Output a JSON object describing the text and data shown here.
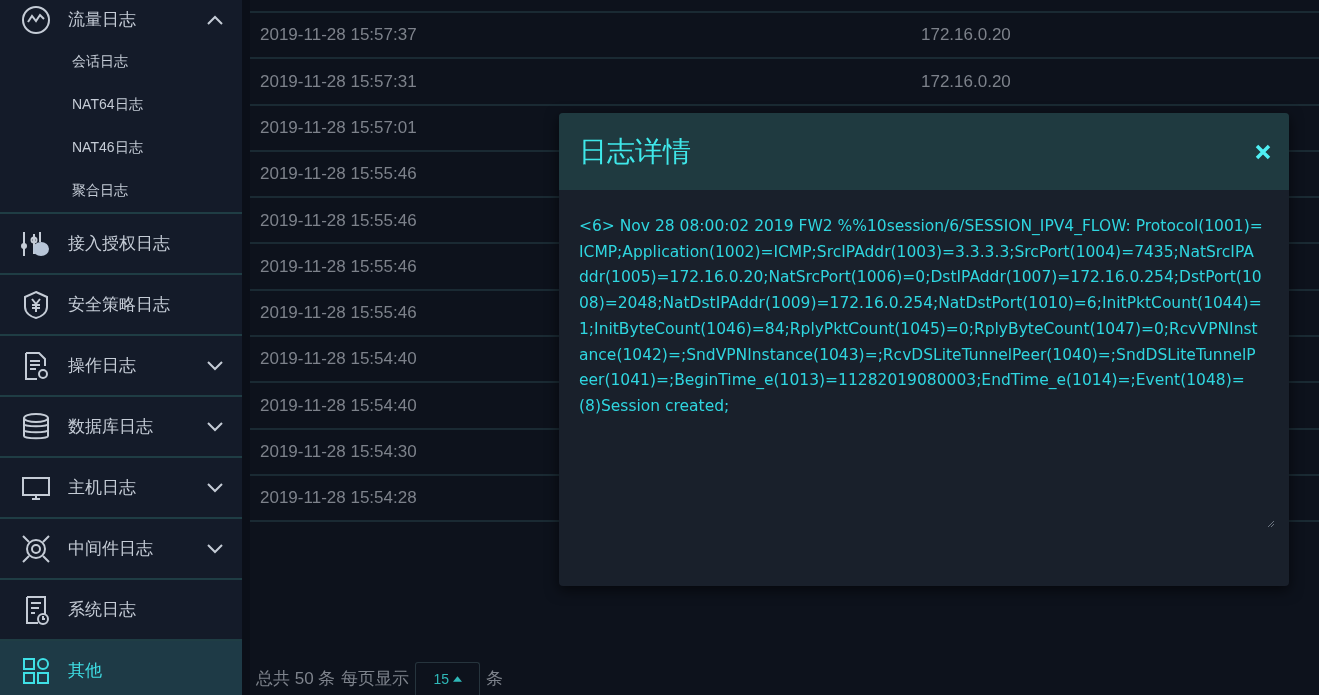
{
  "sidebar": {
    "items": [
      {
        "label": "流量日志",
        "selected": false,
        "expanded": true,
        "children": [
          {
            "label": "会话日志",
            "selected": false
          },
          {
            "label": "NAT64日志",
            "selected": false
          },
          {
            "label": "NAT46日志",
            "selected": false
          },
          {
            "label": "聚合日志",
            "selected": false
          }
        ]
      },
      {
        "label": "接入授权日志",
        "selected": false
      },
      {
        "label": "安全策略日志",
        "selected": false
      },
      {
        "label": "操作日志",
        "selected": false,
        "expanded": false
      },
      {
        "label": "数据库日志",
        "selected": false,
        "expanded": false
      },
      {
        "label": "主机日志",
        "selected": false,
        "expanded": false
      },
      {
        "label": "中间件日志",
        "selected": false,
        "expanded": false
      },
      {
        "label": "系统日志",
        "selected": false
      },
      {
        "label": "其他",
        "selected": true
      }
    ]
  },
  "table": {
    "rows": [
      {
        "time": "2019-11-28 15:57:37",
        "ip": "172.16.0.20"
      },
      {
        "time": "2019-11-28 15:57:31",
        "ip": "172.16.0.20"
      },
      {
        "time": "2019-11-28 15:57:01"
      },
      {
        "time": "2019-11-28 15:55:46"
      },
      {
        "time": "2019-11-28 15:55:46"
      },
      {
        "time": "2019-11-28 15:55:46"
      },
      {
        "time": "2019-11-28 15:55:46"
      },
      {
        "time": "2019-11-28 15:54:40"
      },
      {
        "time": "2019-11-28 15:54:40"
      },
      {
        "time": "2019-11-28 15:54:30"
      },
      {
        "time": "2019-11-28 15:54:28"
      }
    ]
  },
  "pagination": {
    "total": "总共 50 条",
    "per_page_label": "每页显示",
    "page_size": "15",
    "unit": "条"
  },
  "dialog": {
    "title": "日志详情",
    "message": "<6> Nov 28 08:00:02 2019 FW2 %%10session/6/SESSION_IPV4_FLOW: Protocol(1001)=ICMP;Application(1002)=ICMP;SrcIPAddr(1003)=3.3.3.3;SrcPort(1004)=7435;NatSrcIPAddr(1005)=172.16.0.20;NatSrcPort(1006)=0;DstIPAddr(1007)=172.16.0.254;DstPort(1008)=2048;NatDstIPAddr(1009)=172.16.0.254;NatDstPort(1010)=6;InitPktCount(1044)=1;InitByteCount(1046)=84;RplyPktCount(1045)=0;RplyByteCount(1047)=0;RcvVPNInstance(1042)=;SndVPNInstance(1043)=;RcvDSLiteTunnelPeer(1040)=;SndDSLiteTunnelPeer(1041)=;BeginTime_e(1013)=11282019080003;EndTime_e(1014)=;Event(1048)=(8)Session created;"
  }
}
